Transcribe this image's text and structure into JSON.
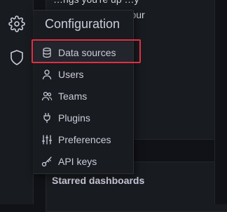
{
  "sidebar": {
    "items": [
      {
        "icon": "gear-icon"
      },
      {
        "icon": "shield-icon"
      }
    ]
  },
  "panel": {
    "text_lines": [
      "…ngs you're up …y",
      "…fi… setting up your",
      "…stallation."
    ]
  },
  "starred": {
    "title": "Starred dashboards"
  },
  "flyout": {
    "header": "Configuration",
    "items": [
      {
        "label": "Data sources",
        "icon": "database-icon"
      },
      {
        "label": "Users",
        "icon": "user-icon"
      },
      {
        "label": "Teams",
        "icon": "users-icon"
      },
      {
        "label": "Plugins",
        "icon": "plug-icon"
      },
      {
        "label": "Preferences",
        "icon": "sliders-icon"
      },
      {
        "label": "API keys",
        "icon": "key-icon"
      }
    ]
  },
  "colors": {
    "highlight": "#e02f44",
    "text": "#ccccdc",
    "background": "#111217",
    "panel": "#181b1f"
  }
}
